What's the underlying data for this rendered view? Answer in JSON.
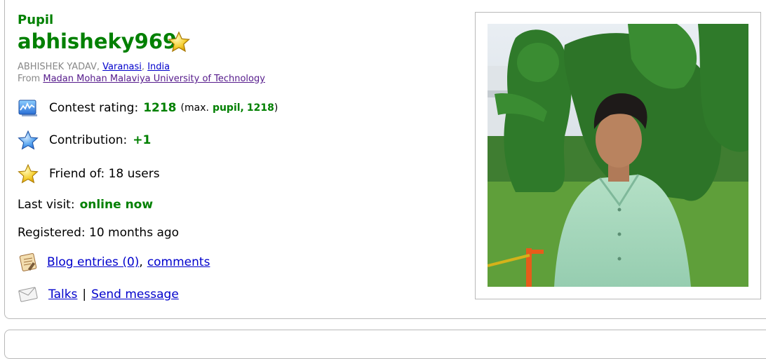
{
  "user": {
    "rank": "Pupil",
    "handle": "abhisheky969",
    "full_name": "ABHISHEK YADAV",
    "city": "Varanasi",
    "country": "India",
    "from_label": "From",
    "organization": "Madan Mohan Malaviya University of Technology"
  },
  "stats": {
    "rating_label": "Contest rating:",
    "rating_value": "1218",
    "max_prefix": "(max.",
    "max_rank": "pupil,",
    "max_value": "1218",
    "max_suffix": ")",
    "contribution_label": "Contribution:",
    "contribution_value": "+1",
    "friend_text": "Friend of: 18 users",
    "last_visit_label": "Last visit:",
    "last_visit_value": "online now",
    "registered_text": "Registered: 10 months ago"
  },
  "links": {
    "blog_entries": "Blog entries (0)",
    "comma": ",",
    "comments": "comments",
    "talks": "Talks",
    "separator": "|",
    "send_message": "Send message"
  },
  "icons": {
    "handle_star": "star-icon",
    "rating": "rating-chart-icon",
    "contribution": "blue-star-icon",
    "friends": "gold-star-icon",
    "blog": "blog-icon",
    "talks": "envelope-icon"
  },
  "colors": {
    "rank_green": "#008000",
    "link_blue": "#0000cc",
    "muted_gray": "#888888"
  }
}
